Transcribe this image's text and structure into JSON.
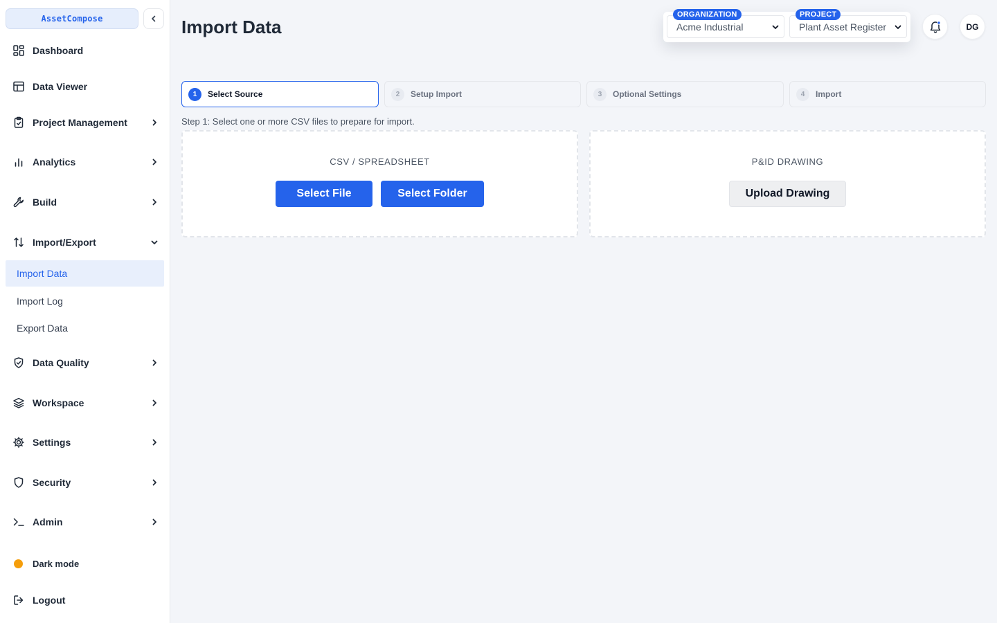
{
  "app": {
    "brand": "AssetCompose"
  },
  "sidebar": {
    "items": [
      {
        "label": "Dashboard",
        "icon": "dashboard-icon"
      },
      {
        "label": "Data Viewer",
        "icon": "table-icon"
      },
      {
        "label": "Project Management",
        "icon": "clipboard-icon"
      },
      {
        "label": "Analytics",
        "icon": "bar-chart-icon"
      },
      {
        "label": "Build",
        "icon": "wrench-icon"
      },
      {
        "label": "Import/Export",
        "icon": "arrows-up-down-icon"
      },
      {
        "label": "Data Quality",
        "icon": "shield-check-icon"
      },
      {
        "label": "Workspace",
        "icon": "layers-icon"
      },
      {
        "label": "Settings",
        "icon": "gear-icon"
      },
      {
        "label": "Security",
        "icon": "shield-icon"
      },
      {
        "label": "Admin",
        "icon": "terminal-icon"
      }
    ],
    "import_export_sub": [
      "Import Data",
      "Import Log",
      "Export Data"
    ],
    "active_sub": "Import Data",
    "dark_mode_label": "Dark mode",
    "logout_label": "Logout"
  },
  "header": {
    "title": "Import Data",
    "organization": {
      "label": "ORGANIZATION",
      "value": "Acme Industrial"
    },
    "project": {
      "label": "PROJECT",
      "value": "Plant Asset Register"
    },
    "avatar_initials": "DG"
  },
  "stepper": {
    "steps": [
      {
        "num": "1",
        "label": "Select Source"
      },
      {
        "num": "2",
        "label": "Setup Import"
      },
      {
        "num": "3",
        "label": "Optional Settings"
      },
      {
        "num": "4",
        "label": "Import"
      }
    ],
    "active_step": 1,
    "hint": "Step 1: Select one or more CSV files to prepare for import."
  },
  "sources": {
    "csv": {
      "title": "CSV / SPREADSHEET",
      "select_file": "Select File",
      "select_folder": "Select Folder"
    },
    "pid": {
      "title": "P&ID DRAWING",
      "upload": "Upload Drawing"
    }
  },
  "colors": {
    "accent": "#2563eb",
    "dark_mode_dot": "#f59e0b",
    "background": "#f3f5f9"
  }
}
